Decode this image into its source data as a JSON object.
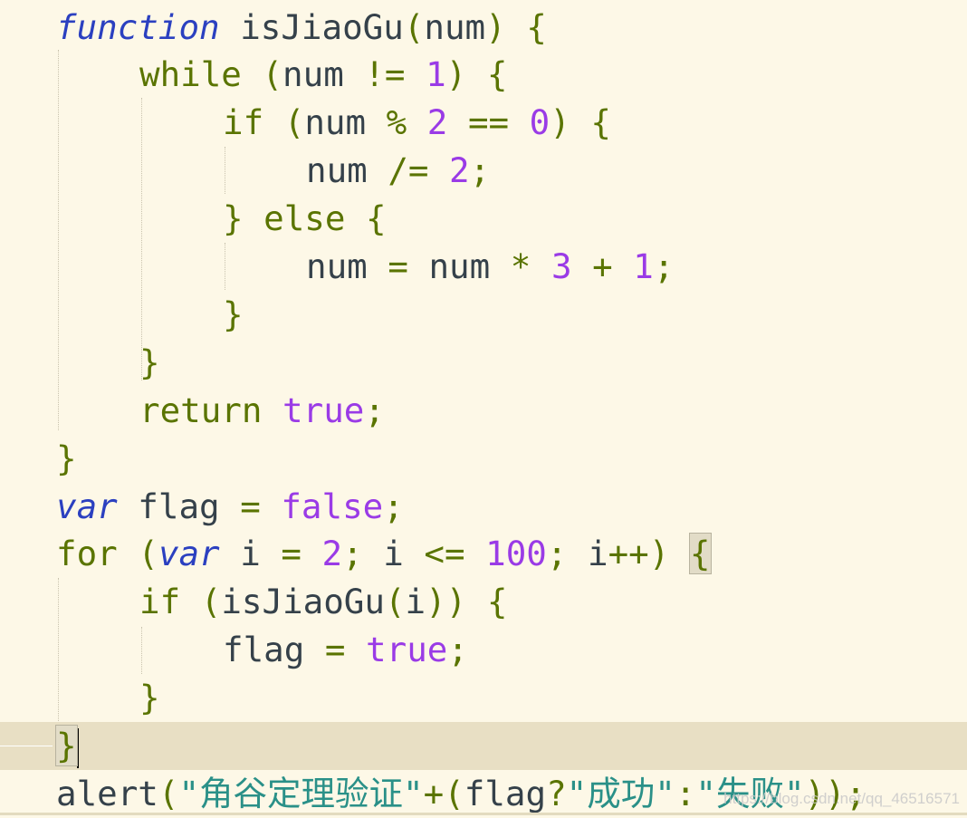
{
  "editor": {
    "language": "javascript",
    "current_line": 16,
    "lines": [
      {
        "indent": 0,
        "tokens": [
          [
            "kwi",
            "function"
          ],
          [
            "id",
            " isJiaoGu"
          ],
          [
            "op",
            "("
          ],
          [
            "id",
            "num"
          ],
          [
            "op",
            ")"
          ],
          [
            "id",
            " "
          ],
          [
            "op",
            "{"
          ]
        ]
      },
      {
        "indent": 1,
        "tokens": [
          [
            "kw",
            "while"
          ],
          [
            "id",
            " "
          ],
          [
            "op",
            "("
          ],
          [
            "id",
            "num "
          ],
          [
            "op",
            "!="
          ],
          [
            "id",
            " "
          ],
          [
            "num",
            "1"
          ],
          [
            "op",
            ")"
          ],
          [
            "id",
            " "
          ],
          [
            "op",
            "{"
          ]
        ]
      },
      {
        "indent": 2,
        "tokens": [
          [
            "kw",
            "if"
          ],
          [
            "id",
            " "
          ],
          [
            "op",
            "("
          ],
          [
            "id",
            "num "
          ],
          [
            "op",
            "%"
          ],
          [
            "id",
            " "
          ],
          [
            "num",
            "2"
          ],
          [
            "id",
            " "
          ],
          [
            "op",
            "=="
          ],
          [
            "id",
            " "
          ],
          [
            "num",
            "0"
          ],
          [
            "op",
            ")"
          ],
          [
            "id",
            " "
          ],
          [
            "op",
            "{"
          ]
        ]
      },
      {
        "indent": 3,
        "tokens": [
          [
            "id",
            "num "
          ],
          [
            "op",
            "/="
          ],
          [
            "id",
            " "
          ],
          [
            "num",
            "2"
          ],
          [
            "op",
            ";"
          ]
        ]
      },
      {
        "indent": 2,
        "tokens": [
          [
            "op",
            "}"
          ],
          [
            "id",
            " "
          ],
          [
            "kw",
            "else"
          ],
          [
            "id",
            " "
          ],
          [
            "op",
            "{"
          ]
        ]
      },
      {
        "indent": 3,
        "tokens": [
          [
            "id",
            "num "
          ],
          [
            "op",
            "="
          ],
          [
            "id",
            " num "
          ],
          [
            "op",
            "*"
          ],
          [
            "id",
            " "
          ],
          [
            "num",
            "3"
          ],
          [
            "id",
            " "
          ],
          [
            "op",
            "+"
          ],
          [
            "id",
            " "
          ],
          [
            "num",
            "1"
          ],
          [
            "op",
            ";"
          ]
        ]
      },
      {
        "indent": 2,
        "tokens": [
          [
            "op",
            "}"
          ]
        ]
      },
      {
        "indent": 1,
        "tokens": [
          [
            "op",
            "}"
          ]
        ]
      },
      {
        "indent": 1,
        "tokens": [
          [
            "kw",
            "return"
          ],
          [
            "id",
            " "
          ],
          [
            "num",
            "true"
          ],
          [
            "op",
            ";"
          ]
        ]
      },
      {
        "indent": 0,
        "tokens": [
          [
            "op",
            "}"
          ]
        ]
      },
      {
        "indent": 0,
        "tokens": [
          [
            "kwi",
            "var"
          ],
          [
            "id",
            " flag "
          ],
          [
            "op",
            "="
          ],
          [
            "id",
            " "
          ],
          [
            "num",
            "false"
          ],
          [
            "op",
            ";"
          ]
        ]
      },
      {
        "indent": 0,
        "tokens": [
          [
            "kw",
            "for"
          ],
          [
            "id",
            " "
          ],
          [
            "op",
            "("
          ],
          [
            "kwi",
            "var"
          ],
          [
            "id",
            " i "
          ],
          [
            "op",
            "="
          ],
          [
            "id",
            " "
          ],
          [
            "num",
            "2"
          ],
          [
            "op",
            ";"
          ],
          [
            "id",
            " i "
          ],
          [
            "op",
            "<="
          ],
          [
            "id",
            " "
          ],
          [
            "num",
            "100"
          ],
          [
            "op",
            ";"
          ],
          [
            "id",
            " i"
          ],
          [
            "op",
            "++"
          ],
          [
            "op",
            ")"
          ],
          [
            "id",
            " "
          ],
          [
            "match",
            "{"
          ]
        ]
      },
      {
        "indent": 1,
        "tokens": [
          [
            "kw",
            "if"
          ],
          [
            "id",
            " "
          ],
          [
            "op",
            "("
          ],
          [
            "id",
            "isJiaoGu"
          ],
          [
            "op",
            "("
          ],
          [
            "id",
            "i"
          ],
          [
            "op",
            "))"
          ],
          [
            "id",
            " "
          ],
          [
            "op",
            "{"
          ]
        ]
      },
      {
        "indent": 2,
        "tokens": [
          [
            "id",
            "flag "
          ],
          [
            "op",
            "="
          ],
          [
            "id",
            " "
          ],
          [
            "num",
            "true"
          ],
          [
            "op",
            ";"
          ]
        ]
      },
      {
        "indent": 1,
        "tokens": [
          [
            "op",
            "}"
          ]
        ]
      },
      {
        "indent": 0,
        "tokens": [
          [
            "match",
            "}"
          ],
          [
            "caret",
            ""
          ]
        ]
      },
      {
        "indent": 0,
        "tokens": [
          [
            "id",
            "alert"
          ],
          [
            "op",
            "("
          ],
          [
            "str",
            "\"角谷定理验证\""
          ],
          [
            "op",
            "+"
          ],
          [
            "op",
            "("
          ],
          [
            "id",
            "flag"
          ],
          [
            "op",
            "?"
          ],
          [
            "str",
            "\"成功\""
          ],
          [
            "op",
            ":"
          ],
          [
            "str",
            "\"失败\""
          ],
          [
            "op",
            "))"
          ],
          [
            "op",
            ";"
          ]
        ]
      }
    ]
  },
  "watermark": "https://blog.csdn.net/qq_46516571"
}
